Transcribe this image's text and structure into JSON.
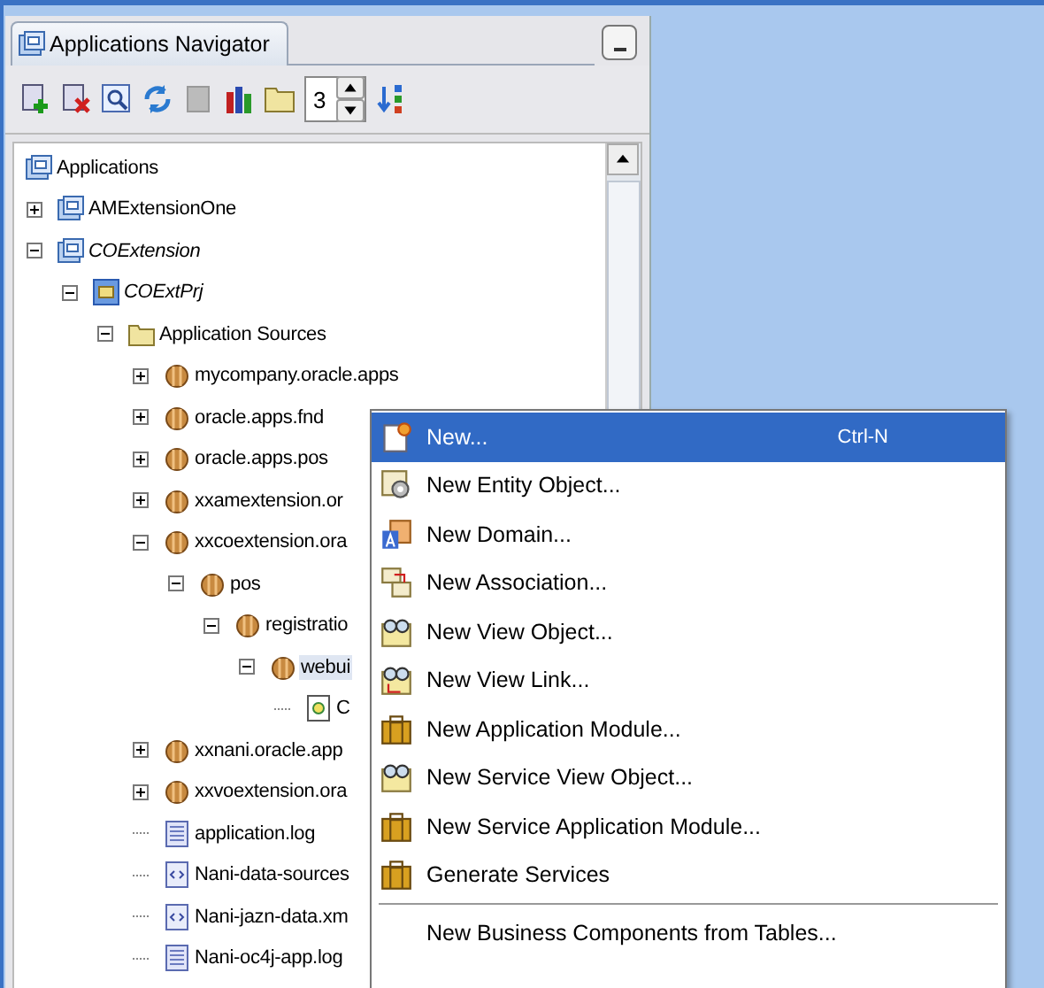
{
  "navigator": {
    "title": "Applications Navigator",
    "toolbar": {
      "level_value": "3"
    },
    "tree": {
      "label": "Applications",
      "kind": "app",
      "children": [
        {
          "label": "AMExtensionOne",
          "kind": "workspace",
          "expanded": false,
          "active": false,
          "selected": false
        },
        {
          "label": "COExtension",
          "kind": "workspace",
          "expanded": true,
          "active": true,
          "selected": false,
          "children": [
            {
              "label": "COExtPrj",
              "kind": "project",
              "expanded": true,
              "active": true,
              "selected": false,
              "children": [
                {
                  "label": "Application Sources",
                  "kind": "folder",
                  "expanded": true,
                  "active": false,
                  "selected": false,
                  "children": [
                    {
                      "label": "mycompany.oracle.apps",
                      "kind": "package",
                      "expanded": false,
                      "active": false,
                      "selected": false
                    },
                    {
                      "label": "oracle.apps.fnd",
                      "kind": "package",
                      "expanded": false,
                      "active": false,
                      "selected": false
                    },
                    {
                      "label": "oracle.apps.pos",
                      "kind": "package",
                      "expanded": false,
                      "active": false,
                      "selected": false
                    },
                    {
                      "label": "xxamextension.or",
                      "kind": "package",
                      "expanded": false,
                      "active": false,
                      "selected": false
                    },
                    {
                      "label": "xxcoextension.ora",
                      "kind": "package",
                      "expanded": true,
                      "active": false,
                      "selected": false,
                      "children": [
                        {
                          "label": "pos",
                          "kind": "package",
                          "expanded": true,
                          "active": false,
                          "selected": false,
                          "children": [
                            {
                              "label": "registratio",
                              "kind": "package",
                              "expanded": true,
                              "active": false,
                              "selected": false,
                              "children": [
                                {
                                  "label": "webui",
                                  "kind": "package",
                                  "expanded": true,
                                  "active": false,
                                  "selected": true,
                                  "children": [
                                    {
                                      "label": "C",
                                      "kind": "page",
                                      "active": false,
                                      "selected": false
                                    }
                                  ]
                                }
                              ]
                            }
                          ]
                        }
                      ]
                    },
                    {
                      "label": "xxnani.oracle.app",
                      "kind": "package",
                      "expanded": false,
                      "active": false,
                      "selected": false
                    },
                    {
                      "label": "xxvoextension.ora",
                      "kind": "package",
                      "expanded": false,
                      "active": false,
                      "selected": false
                    },
                    {
                      "label": "application.log",
                      "kind": "log",
                      "active": false,
                      "selected": false
                    },
                    {
                      "label": "Nani-data-sources",
                      "kind": "xml",
                      "active": false,
                      "selected": false
                    },
                    {
                      "label": "Nani-jazn-data.xm",
                      "kind": "xml",
                      "active": false,
                      "selected": false
                    },
                    {
                      "label": "Nani-oc4j-app.log",
                      "kind": "log",
                      "active": false,
                      "selected": false
                    }
                  ]
                }
              ]
            }
          ]
        }
      ]
    }
  },
  "context_menu": {
    "groups": [
      [
        {
          "label": "New...",
          "shortcut": "Ctrl-N",
          "kind": "new",
          "selected": true
        },
        {
          "label": "New Entity Object...",
          "kind": "entity",
          "selected": false
        },
        {
          "label": "New Domain...",
          "kind": "domain",
          "selected": false
        },
        {
          "label": "New Association...",
          "kind": "association",
          "selected": false
        },
        {
          "label": "New View Object...",
          "kind": "view",
          "selected": false
        },
        {
          "label": "New View Link...",
          "kind": "viewlink",
          "selected": false
        },
        {
          "label": "New Application Module...",
          "kind": "module",
          "selected": false
        },
        {
          "label": "New Service View Object...",
          "kind": "view",
          "selected": false
        },
        {
          "label": "New Service Application Module...",
          "kind": "module",
          "selected": false
        },
        {
          "label": "Generate Services",
          "kind": "module",
          "selected": false
        }
      ],
      [
        {
          "label": "New Business Components from Tables...",
          "kind": "plain",
          "selected": false
        }
      ]
    ]
  }
}
